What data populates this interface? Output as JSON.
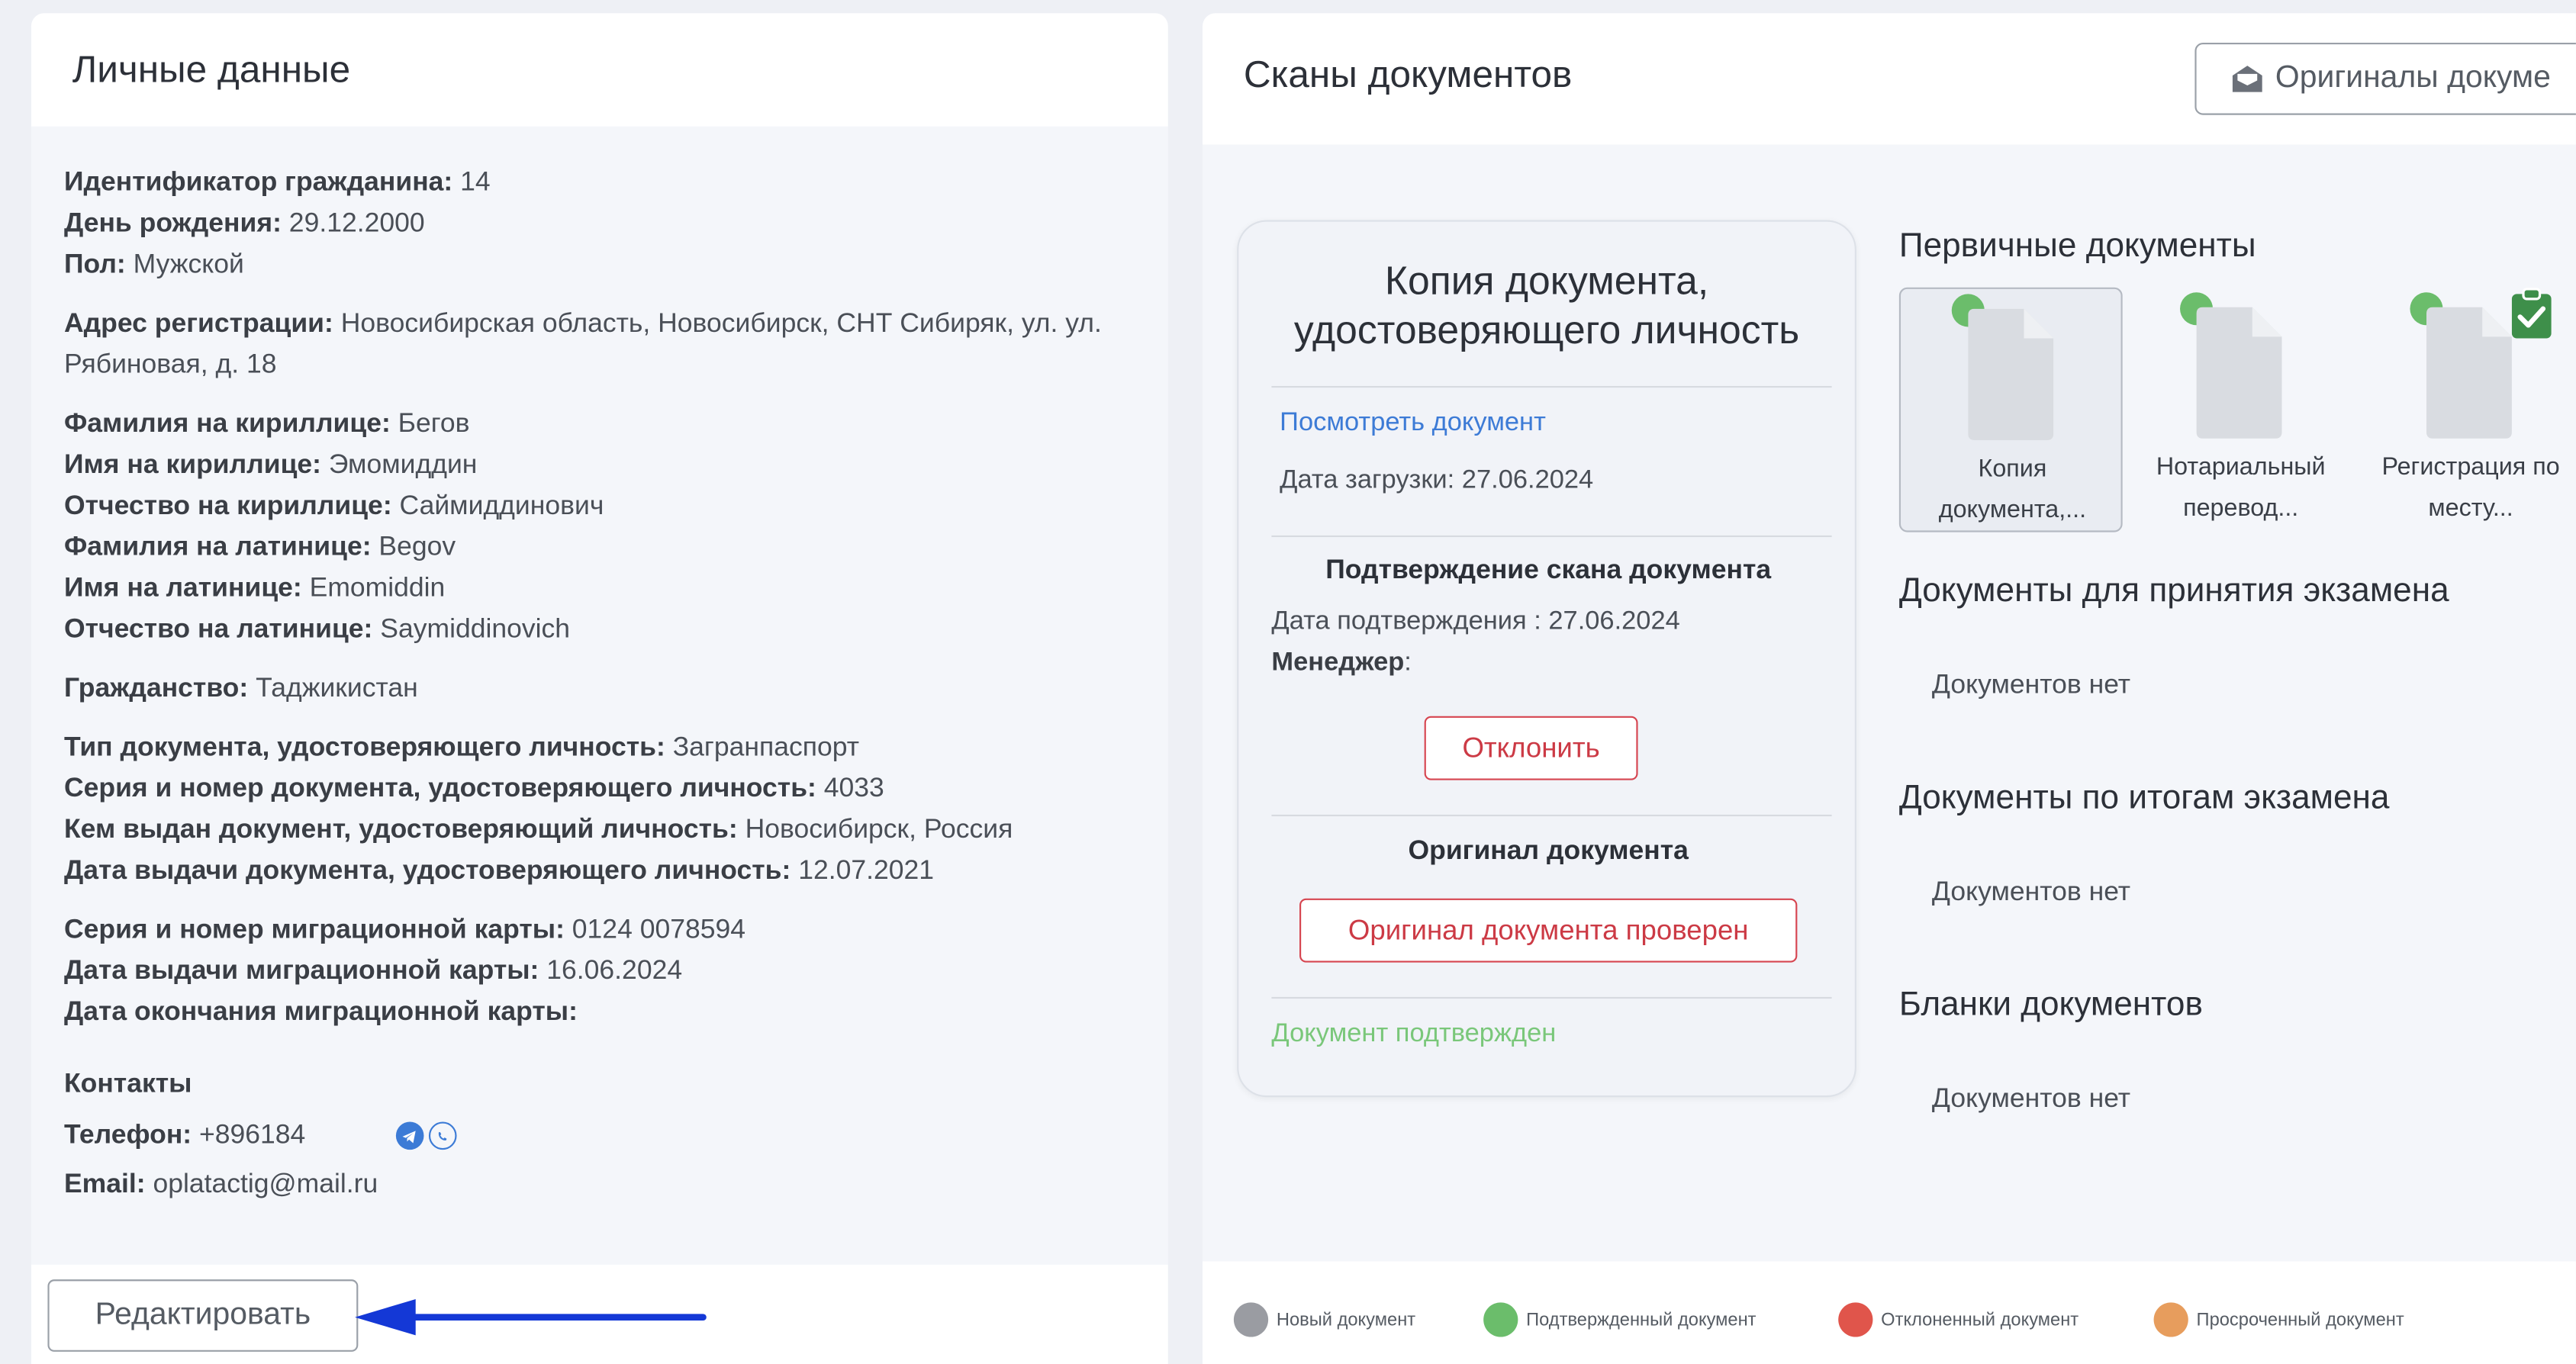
{
  "personal": {
    "title": "Личные данные",
    "groups": [
      [
        {
          "label": "Идентификатор гражданина:",
          "value": " 14"
        },
        {
          "label": "День рождения:",
          "value": " 29.12.2000"
        },
        {
          "label": "Пол:",
          "value": " Мужской"
        }
      ],
      [
        {
          "label": "Адрес регистрации:",
          "value": " Новосибирская область, Новосибирск, СНТ Сибиряк, ул. ул. Рябиновая, д. 18"
        }
      ],
      [
        {
          "label": "Фамилия на кириллице:",
          "value": " Бегов"
        },
        {
          "label": "Имя на кириллице:",
          "value": " Эмомиддин"
        },
        {
          "label": "Отчество на кириллице:",
          "value": " Саймиддинович"
        },
        {
          "label": "Фамилия на латинице:",
          "value": " Begov"
        },
        {
          "label": "Имя на латинице:",
          "value": " Emomiddin"
        },
        {
          "label": "Отчество на латинице:",
          "value": " Saymiddinovich"
        }
      ],
      [
        {
          "label": "Гражданство:",
          "value": " Таджикистан"
        }
      ],
      [
        {
          "label": "Тип документа, удостоверяющего личность:",
          "value": " Загранпаспорт"
        },
        {
          "label": "Серия и номер документа, удостоверяющего личность:",
          "value": " 4033"
        },
        {
          "label": "Кем выдан документ, удостоверяющий личность:",
          "value": " Новосибирск, Россия"
        },
        {
          "label": "Дата выдачи документа, удостоверяющего личность:",
          "value": " 12.07.2021"
        }
      ],
      [
        {
          "label": "Серия и номер миграционной карты:",
          "value": "  0124 0078594"
        },
        {
          "label": "Дата выдачи миграционной карты:",
          "value": " 16.06.2024"
        },
        {
          "label": "Дата окончания миграционной карты:",
          "value": ""
        }
      ]
    ],
    "contacts_title": "Контакты",
    "phone_label": "Телефон:",
    "phone_value": " +896184",
    "email_label": "Email:",
    "email_value": " oplatactig@mail.ru",
    "edit_button": "Редактировать"
  },
  "scans": {
    "title": "Сканы документов",
    "originals_button": "Оригиналы докуме",
    "doc_card": {
      "title": "Копия документа, удостоверяющего личность",
      "view_link": "Посмотреть документ",
      "upload_date": "Дата загрузки: 27.06.2024",
      "confirm_title": "Подтверждение скана документа",
      "confirm_date": "Дата подтверждения : 27.06.2024",
      "manager_label": "Менеджер",
      "manager_colon": ":",
      "reject_button": "Отклонить",
      "original_title": "Оригинал документа",
      "original_button": "Оригинал документа проверен",
      "confirmed_text": "Документ подтвержден"
    },
    "primary_title": "Первичные документы",
    "primary_docs": [
      {
        "line1": "Копия",
        "line2": "документа,..."
      },
      {
        "line1": "Нотариальный",
        "line2": "перевод..."
      },
      {
        "line1": "Регистрация по",
        "line2": "месту..."
      }
    ],
    "exam_docs_title": "Документы для принятия экзамена",
    "exam_docs_empty": "Документов нет",
    "result_docs_title": "Документы по итогам экзамена",
    "result_docs_empty": "Документов нет",
    "forms_title": "Бланки документов",
    "forms_empty": "Документов нет",
    "legend": [
      {
        "label": "Новый документ",
        "color": "#9a9ca2"
      },
      {
        "label": "Подтвержденный документ",
        "color": "#6bbd6b"
      },
      {
        "label": "Отклоненный документ",
        "color": "#e0554b"
      },
      {
        "label": "Просроченный документ",
        "color": "#e79d5d"
      }
    ]
  },
  "colors": {
    "accent_blue": "#3d7bd6",
    "danger": "#cc3a45",
    "success": "#7ac77a",
    "arrow": "#1438d6"
  }
}
